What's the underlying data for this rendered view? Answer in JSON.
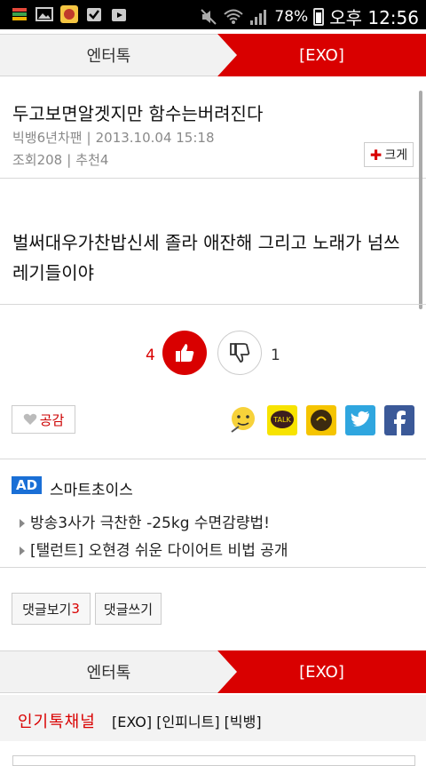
{
  "status": {
    "battery": "78%",
    "time": "오후 12:56"
  },
  "top_tabs": {
    "left": "엔터톡",
    "right": "[EXO]"
  },
  "post": {
    "title": "두고보면알겟지만 함수는버려진다",
    "author": "빅뱅6년차팬",
    "date": "2013.10.04 15:18",
    "views": "조회208",
    "recommend": "추천4",
    "enlarge": "크게",
    "body": "벌써대우가찬밥신세 졸라 애잔해 그리고 노래가 넘쓰레기들이야"
  },
  "votes": {
    "up": "4",
    "down": "1"
  },
  "empathy_label": "공감",
  "share_icons": [
    "mypeople-icon",
    "kakaotalk-icon",
    "kakaostory-icon",
    "twitter-icon",
    "facebook-icon"
  ],
  "ad": {
    "label": "AD",
    "title": "스마트초이스",
    "items": [
      "방송3사가 극찬한 -25kg 수면감량법!",
      "[탤런트] 오현경 쉬운 다이어트 비법 공개"
    ]
  },
  "buttons": {
    "view_comments": "댓글보기",
    "comment_count": "3",
    "write_comment": "댓글쓰기"
  },
  "bottom_tabs": {
    "left": "엔터톡",
    "right": "[EXO]"
  },
  "popular": {
    "label": "인기톡채널",
    "links": "[EXO] [인피니트] [빅뱅]"
  },
  "colors": {
    "accent": "#d90000",
    "ad_blue": "#1a6fd6"
  }
}
